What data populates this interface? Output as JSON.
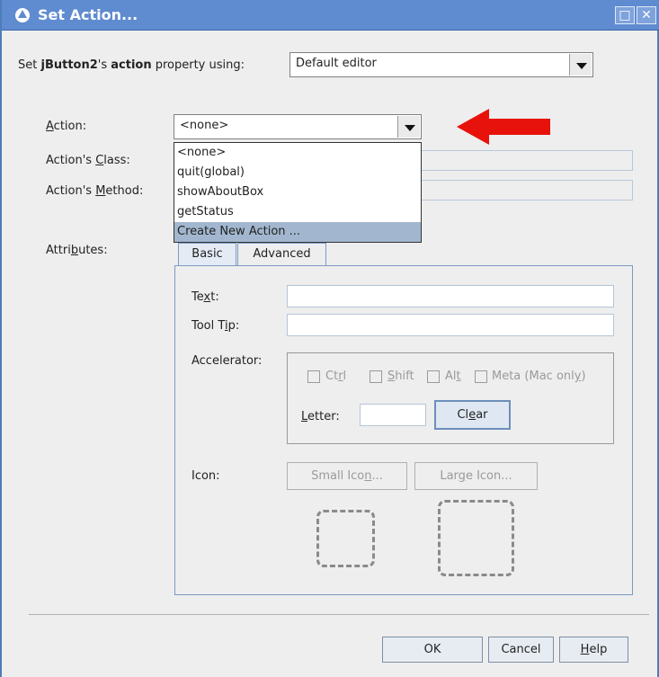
{
  "window": {
    "title": "Set Action...",
    "title_icon": "app-icon",
    "maximize_glyph": "□",
    "close_glyph": "✕"
  },
  "top": {
    "label_prefix": "Set ",
    "label_bold1": "jButton2",
    "label_mid": "'s ",
    "label_bold2": "action",
    "label_suffix": " property using:",
    "editor_value": "Default editor"
  },
  "action": {
    "label_mnemonic": "A",
    "label_rest": "ction:",
    "value": "<none>",
    "options": [
      "<none>",
      "quit(global)",
      "showAboutBox",
      "getStatus",
      "Create New Action ..."
    ],
    "selected_index": 4
  },
  "class_label": {
    "pre": "Action's ",
    "mnemonic": "C",
    "post": "lass:"
  },
  "method_label": {
    "pre": "Action's ",
    "mnemonic": "M",
    "post": "ethod:"
  },
  "attributes_label": {
    "pre": "Attri",
    "mnemonic": "b",
    "post": "utes:"
  },
  "tabs": {
    "basic": "Basic",
    "advanced": "Advanced"
  },
  "basic": {
    "text_label": {
      "pre": "Te",
      "mnemonic": "x",
      "post": "t:"
    },
    "text_value": "",
    "tooltip_label": {
      "pre": "Tool T",
      "mnemonic": "i",
      "post": "p:"
    },
    "tooltip_value": "",
    "accelerator_label": "Accelerator:",
    "ctrl": {
      "pre": "Ct",
      "mnemonic": "r",
      "post": "l"
    },
    "shift": {
      "pre": "",
      "mnemonic": "S",
      "post": "hift"
    },
    "alt": {
      "pre": "Al",
      "mnemonic": "t",
      "post": ""
    },
    "meta": {
      "pre": "Meta (Mac onl",
      "mnemonic": "y",
      "post": ")"
    },
    "letter_label": {
      "pre": "",
      "mnemonic": "L",
      "post": "etter:"
    },
    "letter_value": "",
    "clear_button": {
      "pre": "Cl",
      "mnemonic": "e",
      "post": "ar"
    },
    "icon_label": "Icon:",
    "small_icon_button": {
      "pre": "Small Ico",
      "mnemonic": "n",
      "post": "..."
    },
    "large_icon_button": {
      "pre": "Lar",
      "mnemonic": "g",
      "post": "e Icon..."
    }
  },
  "buttons": {
    "ok": "OK",
    "cancel": "Cancel",
    "help_mnemonic": "H",
    "help_rest": "elp"
  },
  "colors": {
    "titlebar": "#5f8bd0",
    "pointer_arrow": "#e8120c",
    "selection": "#a2b7cf"
  }
}
